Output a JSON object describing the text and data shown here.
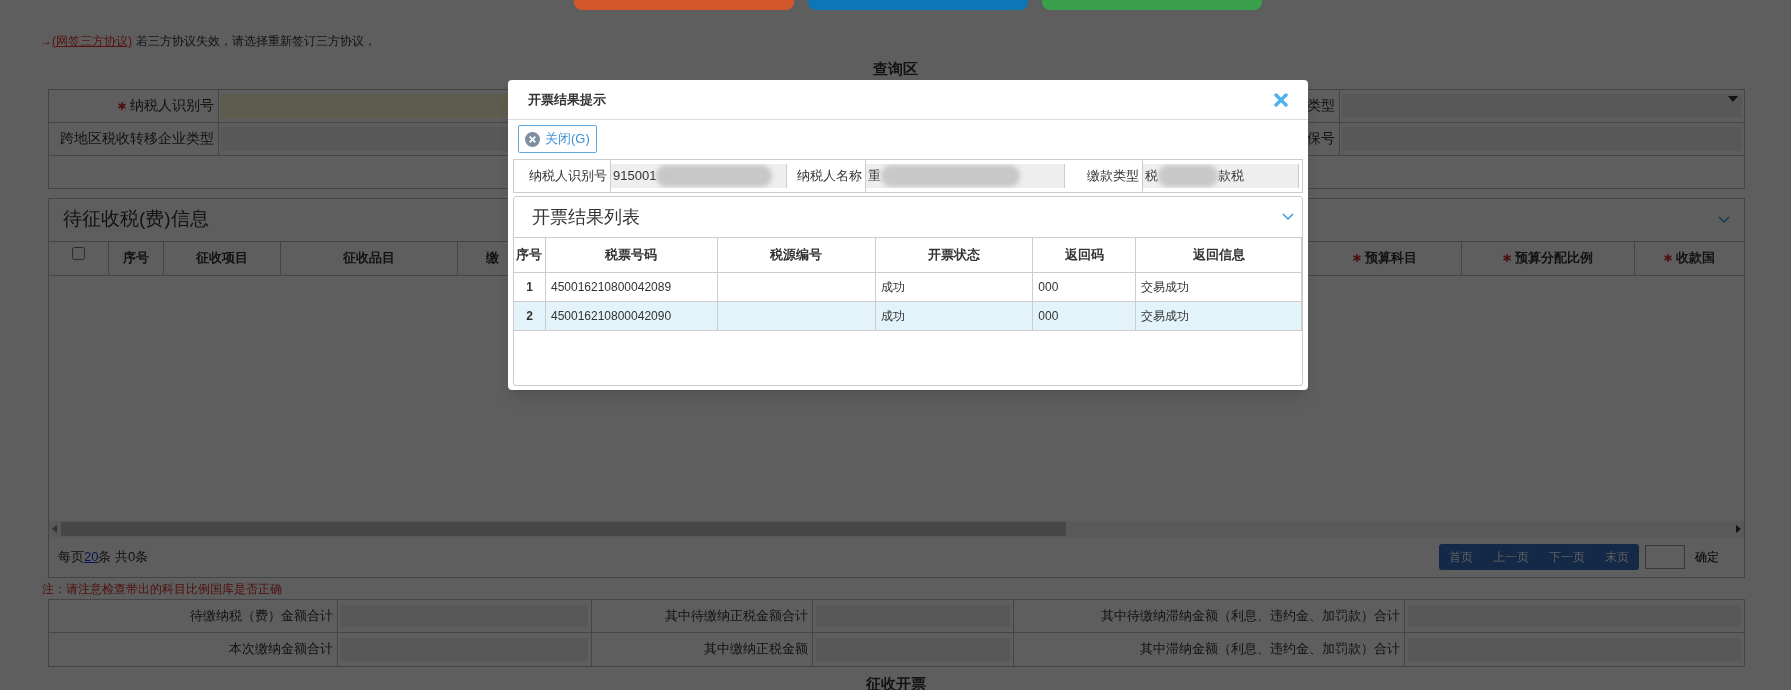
{
  "top_buttons": [
    {
      "color": "#d4562b"
    },
    {
      "color": "#0b77b8"
    },
    {
      "color": "#3aa04c"
    }
  ],
  "notice": {
    "arrow": "→",
    "link": "(网签三方协议)",
    "text": "若三方协议失效，请选择重新签订三方协议，"
  },
  "query_section": {
    "title": "查询区",
    "rows": [
      {
        "label": "纳税人识别号",
        "required": true,
        "right_field": {
          "label": "类型",
          "kind": "select"
        }
      },
      {
        "label": "跨地区税收转移企业类型",
        "required": false,
        "right_field": {
          "label": "保号",
          "kind": "input"
        }
      }
    ]
  },
  "grid": {
    "title": "待征收税(费)信息",
    "select_all": {
      "checked": false
    },
    "columns_left": [
      {
        "label": "序号",
        "required": false
      },
      {
        "label": "征收项目",
        "required": false
      },
      {
        "label": "征收品目",
        "required": false
      },
      {
        "label": "缴",
        "required": false
      }
    ],
    "columns_right": [
      {
        "label": "预算科目",
        "required": true
      },
      {
        "label": "预算分配比例",
        "required": true
      },
      {
        "label": "收款国",
        "required": true
      }
    ],
    "pagination": {
      "before": "每页",
      "page_size": "20",
      "after": "条 共0条",
      "buttons": [
        "首页",
        "上一页",
        "下一页",
        "末页"
      ],
      "confirm": "确定"
    }
  },
  "note": "注：请注意检查带出的科目比例国库是否正确",
  "summary": {
    "rows": [
      [
        "待缴纳税（费）金额合计",
        "其中待缴纳正税金额合计",
        "其中待缴纳滞纳金额（利息、违约金、加罚款）合计"
      ],
      [
        "本次缴纳金额合计",
        "其中缴纳正税金额",
        "其中滞纳金额（利息、违约金、加罚款）合计"
      ]
    ]
  },
  "next_section_title": "征收开票",
  "dialog": {
    "title": "开票结果提示",
    "close_button": "关闭(G)",
    "info": [
      {
        "label": "纳税人识别号",
        "value": [
          "915001"
        ]
      },
      {
        "label": "纳税人名称",
        "value": [
          "重"
        ]
      },
      {
        "label": "缴款类型",
        "value": [
          "税",
          "款税"
        ]
      }
    ],
    "panel": {
      "title": "开票结果列表",
      "expanded": true,
      "columns": [
        "序号",
        "税票号码",
        "税源编号",
        "开票状态",
        "返回码",
        "返回信息"
      ],
      "rows": [
        {
          "no": "1",
          "ticket_no": "450016210800042089",
          "status": "成功",
          "code": "000",
          "message": "交易成功",
          "selected": false
        },
        {
          "no": "2",
          "ticket_no": "450016210800042090",
          "status": "成功",
          "code": "000",
          "message": "交易成功",
          "selected": true
        }
      ]
    }
  }
}
